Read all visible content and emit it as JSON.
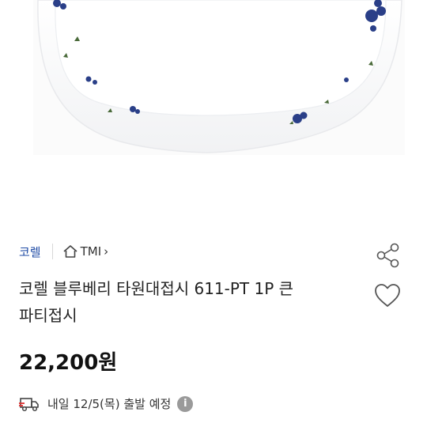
{
  "product": {
    "brand_label": "코렐",
    "tmi_label": "TMI",
    "tmi_chevron": "›",
    "title_line1": "코렐 블루베리 타원대접시 611-PT 1P 큰",
    "title_line2": "파티접시",
    "price": "22,200원",
    "shipping_text": "내일 12/5(목) 출발 예정",
    "info_glyph": "i"
  },
  "icons": {
    "home": "home-icon",
    "share": "share-icon",
    "heart": "heart-icon",
    "truck": "truck-icon",
    "info": "info-icon"
  },
  "colors": {
    "brand": "#1f4ba5",
    "truck_accent": "#e03030",
    "blueberry": "#2a3f88"
  }
}
